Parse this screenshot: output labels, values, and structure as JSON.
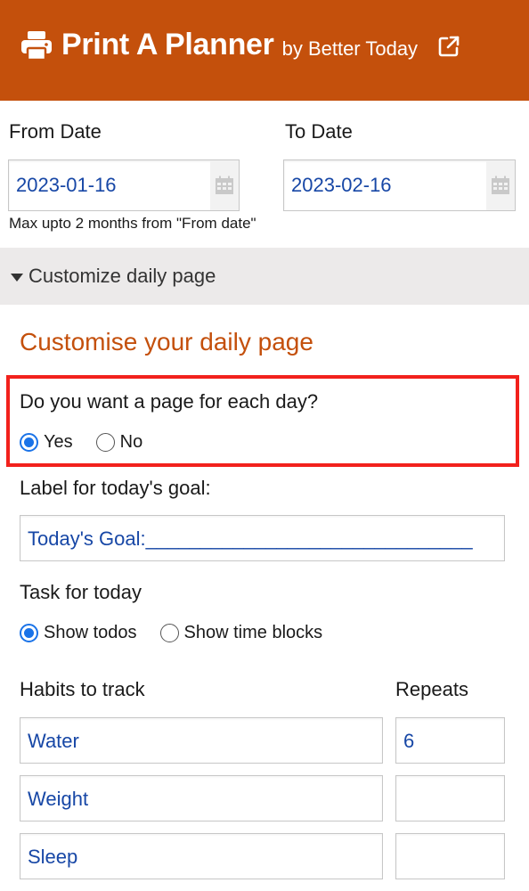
{
  "header": {
    "brand": "Print A Planner",
    "byline": "by Better Today",
    "bg_color": "#c4500c",
    "icons": {
      "left": "printer-icon",
      "right": "external-link-icon"
    }
  },
  "dates": {
    "from_label": "From Date",
    "from_value": "2023-01-16",
    "to_label": "To Date",
    "to_value": "2023-02-16",
    "note": "Max upto 2 months from \"From date\""
  },
  "customize": {
    "toggle_label": "Customize daily page",
    "section_title": "Customise your daily page"
  },
  "page_each_day": {
    "question": "Do you want a page for each day?",
    "options": [
      "Yes",
      "No"
    ],
    "selected": "Yes"
  },
  "goal": {
    "label": "Label for today's goal:",
    "value": "Today's Goal:______________________________"
  },
  "task": {
    "label": "Task for today",
    "options": [
      "Show todos",
      "Show time blocks"
    ],
    "selected": "Show todos"
  },
  "habits": {
    "label": "Habits to track",
    "repeats_label": "Repeats",
    "rows": [
      {
        "habit": "Water",
        "repeats": "6"
      },
      {
        "habit": "Weight",
        "repeats": ""
      },
      {
        "habit": "Sleep",
        "repeats": ""
      }
    ]
  },
  "colors": {
    "accent": "#c4500c",
    "input_text": "#1747a6",
    "radio_selected": "#1a73e8",
    "highlight_border": "#f2211c"
  }
}
